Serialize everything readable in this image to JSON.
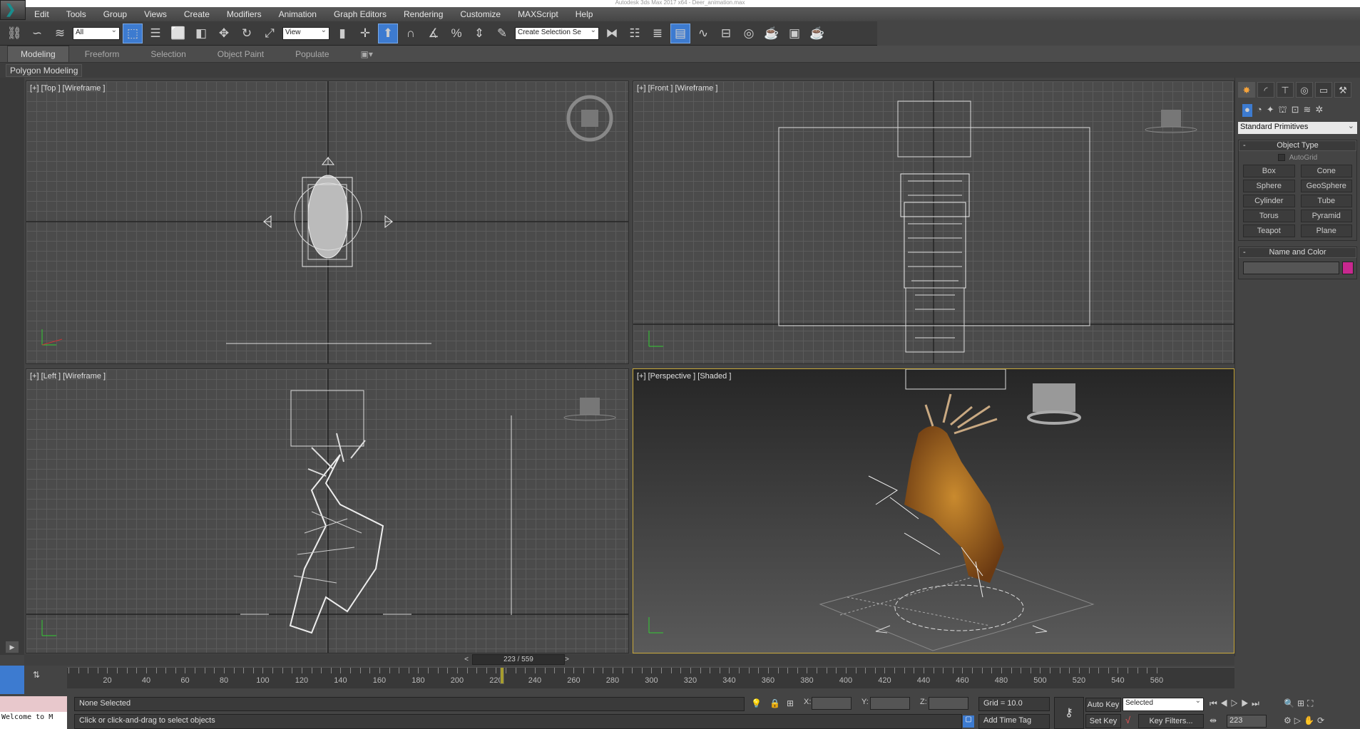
{
  "title": "Autodesk 3ds Max 2017 x64 - Deer_animation.max",
  "menu": [
    "Edit",
    "Tools",
    "Group",
    "Views",
    "Create",
    "Modifiers",
    "Animation",
    "Graph Editors",
    "Rendering",
    "Customize",
    "MAXScript",
    "Help"
  ],
  "toolbar": {
    "selection_filter": "All",
    "ref_coord": "View",
    "named_selection": "Create Selection Se"
  },
  "ribbon": {
    "tabs": [
      "Modeling",
      "Freeform",
      "Selection",
      "Object Paint",
      "Populate"
    ],
    "active": "Modeling",
    "panel": "Polygon Modeling"
  },
  "viewports": {
    "top": "[+] [Top ] [Wireframe ]",
    "front": "[+] [Front ] [Wireframe ]",
    "left": "[+] [Left ] [Wireframe ]",
    "perspective": "[+] [Perspective ] [Shaded ]"
  },
  "command_panel": {
    "category": "Standard Primitives",
    "object_type_title": "Object Type",
    "autogrid": "AutoGrid",
    "buttons": [
      "Box",
      "Cone",
      "Sphere",
      "GeoSphere",
      "Cylinder",
      "Tube",
      "Torus",
      "Pyramid",
      "Teapot",
      "Plane"
    ],
    "name_color_title": "Name and Color",
    "color": "#c8288f"
  },
  "timeline": {
    "current": "223 / 559",
    "frame": 223,
    "max": 559,
    "ticks": [
      20,
      40,
      60,
      80,
      100,
      120,
      140,
      160,
      180,
      200,
      220,
      240,
      260,
      280,
      300,
      320,
      340,
      360,
      380,
      400,
      420,
      440,
      460,
      480,
      500,
      520,
      540,
      560
    ]
  },
  "status": {
    "selection": "None Selected",
    "prompt": "Click or click-and-drag to select objects",
    "maxscript": "Welcome to M",
    "x_label": "X:",
    "y_label": "Y:",
    "z_label": "Z:",
    "grid": "Grid = 10.0",
    "add_time_tag": "Add Time Tag",
    "auto_key": "Auto Key",
    "set_key": "Set Key",
    "key_mode": "Selected",
    "key_filters": "Key Filters...",
    "frame_field": "223"
  }
}
